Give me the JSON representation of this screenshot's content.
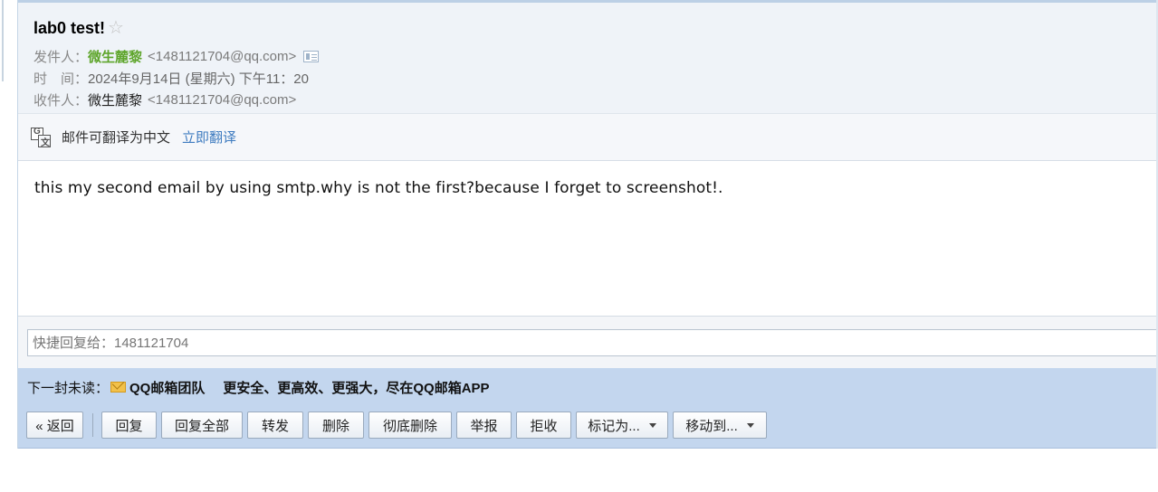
{
  "subject": "lab0 test!",
  "star_glyph": "☆",
  "meta": {
    "from_label": "发件人：",
    "from_name": "微生麓黎",
    "from_addr": "<1481121704@qq.com>",
    "time_label": "时　间：",
    "time_value": "2024年9月14日 (星期六) 下午11：20",
    "to_label": "收件人：",
    "to_name": "微生麓黎",
    "to_addr": "<1481121704@qq.com>"
  },
  "translate": {
    "text": "邮件可翻译为中文",
    "link": "立即翻译"
  },
  "body_text": "this my second email by using smtp.why is not the first?because I forget to screenshot!.",
  "quick_reply": {
    "placeholder": "快捷回复给：1481121704"
  },
  "next_unread": {
    "label": "下一封未读：",
    "from": "QQ邮箱团队",
    "subject": "更安全、更高效、更强大，尽在QQ邮箱APP"
  },
  "toolbar": {
    "back": "« 返回",
    "reply": "回复",
    "reply_all": "回复全部",
    "forward": "转发",
    "delete": "删除",
    "delete_permanent": "彻底删除",
    "report": "举报",
    "reject": "拒收",
    "mark_as": "标记为...",
    "move_to": "移动到..."
  }
}
